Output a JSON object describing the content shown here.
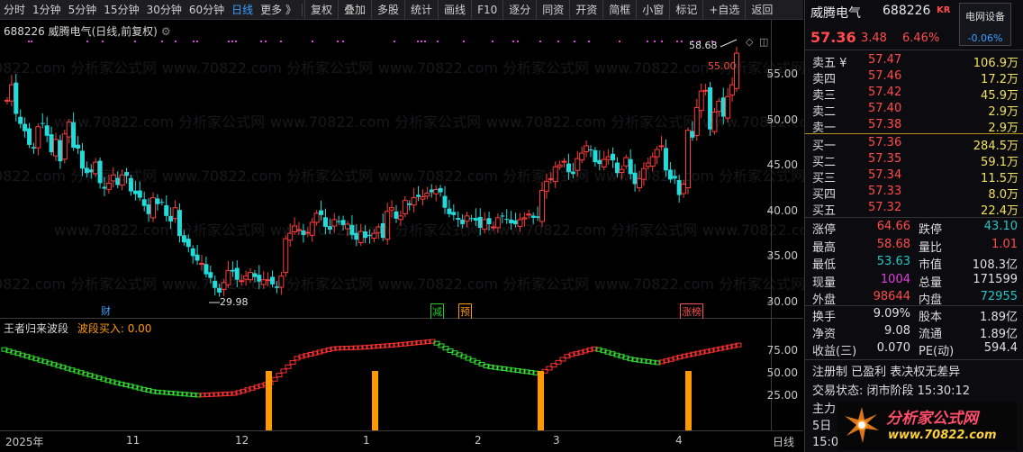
{
  "toolbar": {
    "periods": [
      "分时",
      "1分钟",
      "5分钟",
      "15分钟",
      "30分钟",
      "60分钟",
      "日线",
      "更多 》"
    ],
    "active_period": "日线",
    "buttons": [
      "复权",
      "叠加",
      "多股",
      "统计",
      "画线",
      "F10",
      "逐分",
      "同资",
      "开资",
      "简框",
      "小窗",
      "标记",
      "+自选",
      "返回"
    ]
  },
  "chart": {
    "header": "688226 威腾电气(日线,前复权)",
    "high_label": "58.68",
    "high_price_label": "55.00",
    "low_label": "29.98",
    "tags": [
      "财",
      "减",
      "预",
      "涨榜"
    ],
    "watermark": "www.70822.com 分析家公式网",
    "y_ticks": [
      "55.00",
      "50.00",
      "45.00",
      "40.00",
      "35.00",
      "30.00"
    ]
  },
  "indicator": {
    "name": "王者归来波段",
    "value_label": "波段买入: 0.00",
    "y_ticks": [
      "75.00",
      "50.00",
      "25.00"
    ]
  },
  "time_axis": {
    "labels": [
      "2025年",
      "11",
      "12",
      "1",
      "2",
      "3",
      "4"
    ],
    "period": "日线"
  },
  "colors": {
    "up": "#ff3b3b",
    "down": "#22dcdc",
    "wave_up": "#ff3030",
    "wave_down": "#33dd33",
    "buy_bar": "#ff9900",
    "magenta_dot": "#e040e0"
  },
  "quote": {
    "name": "威腾电气",
    "code": "688226",
    "exchange_badge": "KR",
    "sector": "电网设备",
    "sector_change": "-0.06%",
    "price": "57.36",
    "change": "3.48",
    "change_pct": "6.46%",
    "asks": [
      {
        "label": "卖五 ¥",
        "price": "57.47",
        "vol": "106.9万"
      },
      {
        "label": "卖四",
        "price": "57.46",
        "vol": "17.2万"
      },
      {
        "label": "卖三",
        "price": "57.42",
        "vol": "45.9万"
      },
      {
        "label": "卖二",
        "price": "57.40",
        "vol": "2.9万"
      },
      {
        "label": "卖一",
        "price": "57.38",
        "vol": "2.9万"
      }
    ],
    "bids": [
      {
        "label": "买一",
        "price": "57.36",
        "vol": "284.5万"
      },
      {
        "label": "买二",
        "price": "57.35",
        "vol": "59.1万"
      },
      {
        "label": "买三",
        "price": "57.34",
        "vol": "11.5万"
      },
      {
        "label": "买四",
        "price": "57.33",
        "vol": "8.0万"
      },
      {
        "label": "买五",
        "price": "57.32",
        "vol": "22.4万"
      }
    ],
    "stats": [
      [
        "涨停",
        "64.66",
        "跌停",
        "43.10"
      ],
      [
        "最高",
        "58.68",
        "量比",
        "1.01"
      ],
      [
        "最低",
        "53.63",
        "市值",
        "108.3亿"
      ],
      [
        "现量",
        "1004",
        "总量",
        "171599"
      ],
      [
        "外盘",
        "98644",
        "内盘",
        "72955"
      ]
    ],
    "stats2": [
      [
        "换手",
        "9.09%",
        "股本",
        "1.89亿"
      ],
      [
        "净资",
        "9.08",
        "流通",
        "1.89亿"
      ],
      [
        "收益(三)",
        "0.070",
        "PE(动)",
        "594.4"
      ]
    ],
    "notice": "注册制 已盈利 表决权无差异",
    "status": "交易状态: 闭市阶段 15:30:12",
    "footer_a": "主力",
    "footer_b": "5日",
    "footer_c": "15:0"
  },
  "logo": {
    "main": "分析家公式网",
    "url": "www.70822.com"
  }
}
